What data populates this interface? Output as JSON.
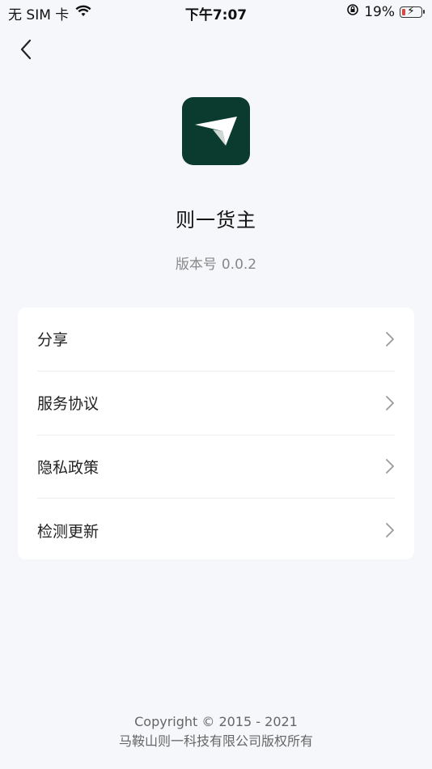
{
  "status_bar": {
    "carrier": "无 SIM 卡",
    "time": "下午7:07",
    "battery_percent": "19%"
  },
  "header": {
    "back_icon": "chevron-left-icon"
  },
  "app": {
    "name": "则一货主",
    "version_label": "版本号",
    "version_value": "0.0.2",
    "logo_color": "#0b3b2e"
  },
  "menu": {
    "items": [
      {
        "label": "分享"
      },
      {
        "label": "服务协议"
      },
      {
        "label": "隐私政策"
      },
      {
        "label": "检测更新"
      }
    ]
  },
  "footer": {
    "copyright": "Copyright © 2015 - 2021",
    "company": "马鞍山则一科技有限公司版权所有"
  }
}
